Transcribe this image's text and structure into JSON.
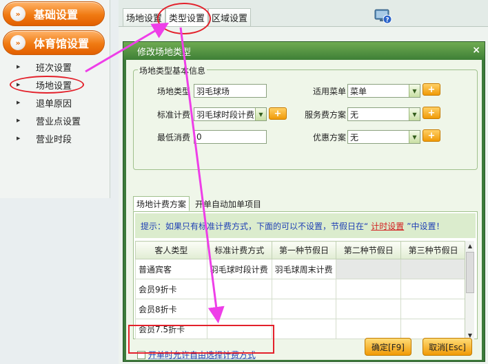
{
  "sidebar": {
    "categories": [
      {
        "label": "基础设置",
        "icon": "double-chevron-right-icon"
      },
      {
        "label": "体育馆设置",
        "icon": "double-chevron-down-icon"
      }
    ],
    "items": [
      {
        "label": "班次设置"
      },
      {
        "label": "场地设置"
      },
      {
        "label": "退单原因"
      },
      {
        "label": "营业点设置"
      },
      {
        "label": "营业时段"
      }
    ]
  },
  "top_tabs": [
    {
      "label": "场地设置"
    },
    {
      "label": "类型设置"
    },
    {
      "label": "区域设置"
    }
  ],
  "dialog": {
    "title": "修改场地类型",
    "close_glyph": "×",
    "basic_group": {
      "legend": "场地类型基本信息",
      "fields": {
        "venue_type": {
          "label": "场地类型",
          "value": "羽毛球场"
        },
        "standard_fee": {
          "label": "标准计费",
          "value": "羽毛球时段计费"
        },
        "min_spend": {
          "label": "最低消费",
          "value": "0"
        },
        "menu": {
          "label": "适用菜单",
          "value": "菜单"
        },
        "service_fee": {
          "label": "服务费方案",
          "value": "无"
        },
        "discount": {
          "label": "优惠方案",
          "value": "无"
        }
      },
      "plus_label": "+"
    },
    "inner_tabs": [
      {
        "label": "场地计费方案"
      },
      {
        "label": "开单自动加单项目"
      }
    ],
    "hint": {
      "before": "提示：如果只有标准计费方式，下面的可以不设置，节假日在“",
      "link": "计时设置",
      "after": "”中设置！"
    },
    "grid": {
      "headers": [
        "客人类型",
        "标准计费方式",
        "第一种节假日",
        "第二种节假日",
        "第三种节假日"
      ],
      "rows": [
        [
          "普通宾客",
          "羽毛球时段计费",
          "羽毛球周末计费",
          "",
          ""
        ],
        [
          "会员9折卡",
          "",
          "",
          "",
          ""
        ],
        [
          "会员8折卡",
          "",
          "",
          "",
          ""
        ],
        [
          "会员7.5折卡",
          "",
          "",
          "",
          ""
        ]
      ]
    },
    "free_choose_label": "开单时允许自由选择计费方式",
    "free_choose_checked": false,
    "confirm_label": "确定[F9]",
    "cancel_label": "取消[Esc]"
  },
  "colors": {
    "accent_orange": "#f07a12",
    "dialog_green": "#3c7a3a",
    "annotation_red": "#e3202a",
    "annotation_arrow": "#ee3ee8",
    "hint_blue": "#1f3fb5"
  }
}
